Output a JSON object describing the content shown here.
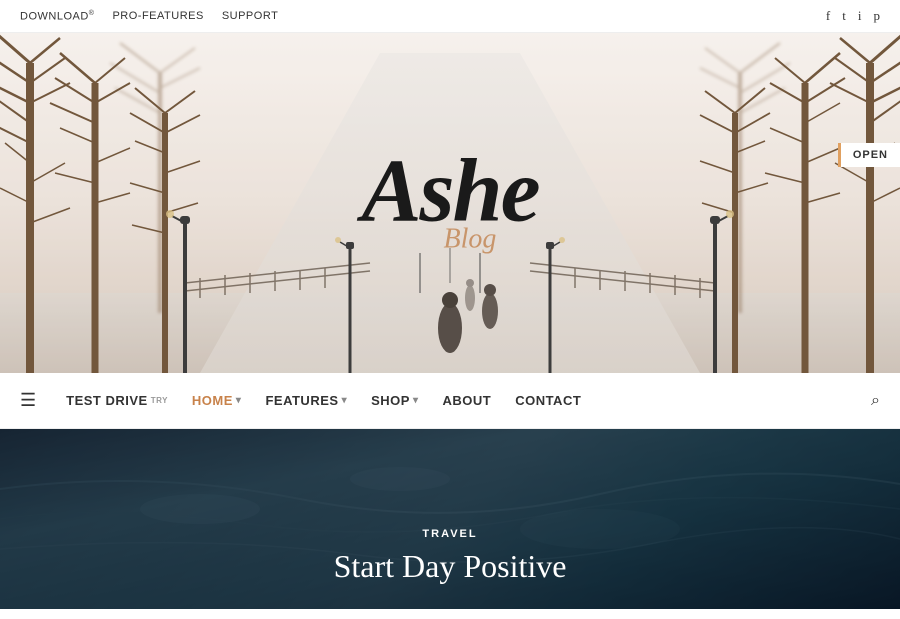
{
  "topbar": {
    "links": [
      {
        "label": "DOWNLOAD",
        "sup": "®"
      },
      {
        "label": "PRO-FEATURES",
        "sup": ""
      },
      {
        "label": "SUPPORT",
        "sup": ""
      }
    ],
    "social": [
      "facebook",
      "twitter",
      "instagram",
      "pinterest"
    ]
  },
  "hero": {
    "logo_main": "Ashe",
    "logo_sub": "Blog",
    "open_badge": "OPEN"
  },
  "navbar": {
    "items": [
      {
        "label": "TEST DRIVE",
        "sup": "TRY",
        "active": false,
        "hasDropdown": false
      },
      {
        "label": "HOME",
        "active": true,
        "hasDropdown": true
      },
      {
        "label": "FEATURES",
        "active": false,
        "hasDropdown": true
      },
      {
        "label": "SHOP",
        "active": false,
        "hasDropdown": true
      },
      {
        "label": "ABOUT",
        "active": false,
        "hasDropdown": false
      },
      {
        "label": "CONTACT",
        "active": false,
        "hasDropdown": false
      }
    ]
  },
  "article": {
    "category": "TRAVEL",
    "title": "Start Day Positive"
  }
}
